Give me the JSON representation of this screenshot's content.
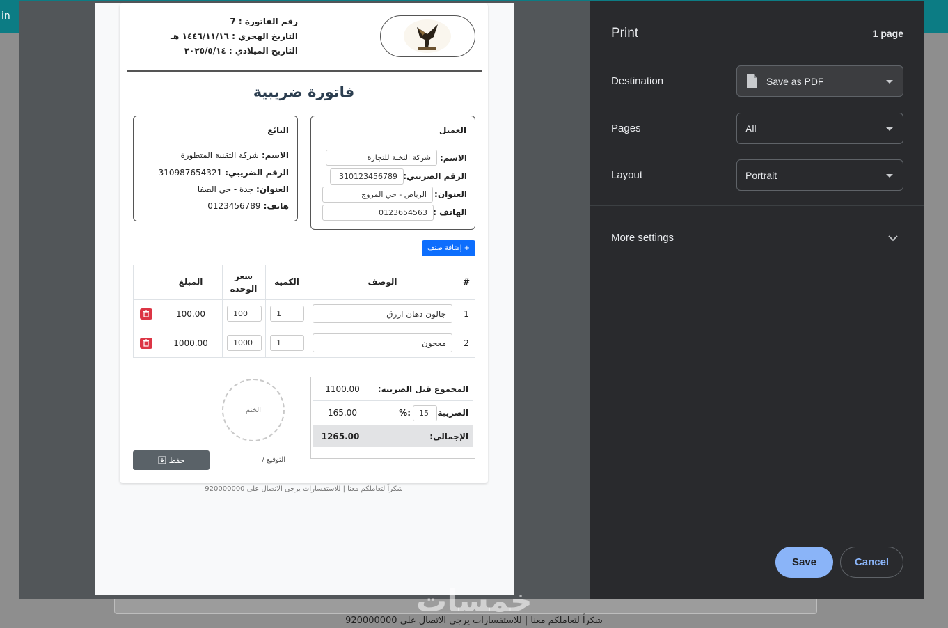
{
  "topbar": {
    "text": "in"
  },
  "background": {
    "footer": "شكراً لتعاملكم معنا | للاستفسارات يرجى الاتصال على 920000000",
    "watermark": "خمسات"
  },
  "invoice": {
    "meta": {
      "number": "رقم الفاتورة : 7",
      "hijri_date": "التاريخ الهجري : ١٤٤٦/١١/١٦ هـ",
      "greg_date": "التاريخ الميلادي : ٢٠٢٥/٥/١٤"
    },
    "title": "فاتورة ضريبية",
    "seller": {
      "heading": "البائع",
      "name_label": "الاسم:",
      "name_value": "شركة التقنية المتطورة",
      "tax_label": "الرقم الضريبي:",
      "tax_value": "310987654321",
      "address_label": "العنوان:",
      "address_value": "جدة - حي الصفا",
      "phone_label": "هاتف:",
      "phone_value": "0123456789"
    },
    "customer": {
      "heading": "العميل",
      "name_label": "الاسم:",
      "name_value": "شركة النخبة للتجارة",
      "tax_label": "الرقم الضريبي:",
      "tax_value": "310123456789",
      "address_label": "العنوان:",
      "address_value": "الرياض - حي المروج",
      "phone_label": "الهاتف :",
      "phone_value": "0123654563"
    },
    "add_item_label": "+ إضافة صنف",
    "table": {
      "headers": {
        "num": "#",
        "desc": "الوصف",
        "qty": "الكمية",
        "price": "سعر الوحدة",
        "amount": "المبلغ"
      },
      "rows": [
        {
          "num": "1",
          "desc": "جالون دهان ازرق",
          "qty": "1",
          "price": "100",
          "amount": "100.00"
        },
        {
          "num": "2",
          "desc": "معجون",
          "qty": "1",
          "price": "1000",
          "amount": "1000.00"
        }
      ]
    },
    "totals": {
      "subtotal_label": "المجموع قبل الضريبة:",
      "subtotal_value": "1100.00",
      "tax_label": "الضريبة",
      "tax_rate": "15",
      "tax_percent": "%:",
      "tax_value": "165.00",
      "total_label": "الإجمالي:",
      "total_value": "1265.00"
    },
    "stamp_label": "الختم",
    "signature_label": "التوقيع /",
    "save_label": "حفظ",
    "footer": "شكراً لتعاملكم معنا | للاستفسارات يرجى الاتصال على 920000000"
  },
  "print_panel": {
    "title": "Print",
    "page_count": "1 page",
    "destination_label": "Destination",
    "destination_value": "Save as PDF",
    "pages_label": "Pages",
    "pages_value": "All",
    "layout_label": "Layout",
    "layout_value": "Portrait",
    "more_settings": "More settings",
    "save_button": "Save",
    "cancel_button": "Cancel"
  },
  "colors": {
    "primary": "#0d6efd",
    "danger": "#dc3545",
    "panel_bg": "#292a2d",
    "save_bg": "#8ab4f8",
    "teal": "#0c7c84"
  }
}
